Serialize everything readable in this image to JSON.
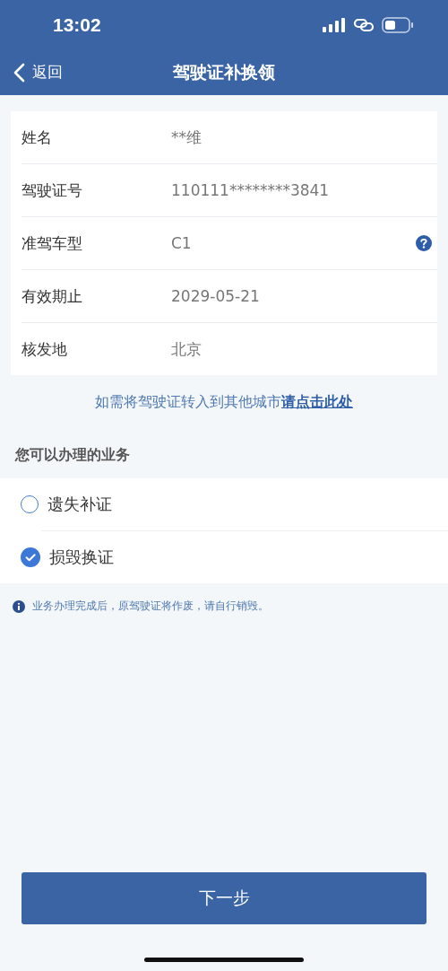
{
  "status_bar": {
    "time": "13:02"
  },
  "nav": {
    "back": "返回",
    "title": "驾驶证补换领"
  },
  "license_info": [
    {
      "label": "姓名",
      "value": "**维",
      "help": false
    },
    {
      "label": "驾驶证号",
      "value": "110111********3841",
      "help": false
    },
    {
      "label": "准驾车型",
      "value": "C1",
      "help": true
    },
    {
      "label": "有效期止",
      "value": "2029-05-21",
      "help": false
    },
    {
      "label": "核发地",
      "value": "北京",
      "help": false
    }
  ],
  "transfer_note": {
    "text": "如需将驾驶证转入到其他城市",
    "link": "请点击此处"
  },
  "services": {
    "title": "您可以办理的业务",
    "options": [
      {
        "label": "遗失补证",
        "selected": false
      },
      {
        "label": "损毁换证",
        "selected": true
      }
    ]
  },
  "notice": "业务办理完成后，原驾驶证将作废，请自行销毁。",
  "next_button": "下一步"
}
